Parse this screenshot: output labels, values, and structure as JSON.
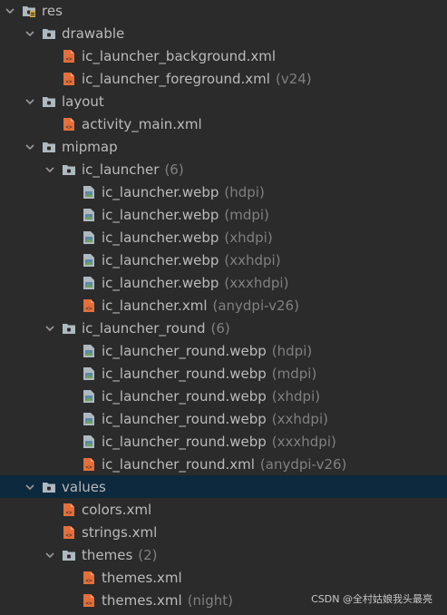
{
  "tree": [
    {
      "label": "res",
      "hint": "",
      "depth": 0,
      "kind": "folder-res",
      "expandable": true
    },
    {
      "label": "drawable",
      "hint": "",
      "depth": 1,
      "kind": "folder",
      "expandable": true
    },
    {
      "label": "ic_launcher_background.xml",
      "hint": "",
      "depth": 2,
      "kind": "xml",
      "expandable": false
    },
    {
      "label": "ic_launcher_foreground.xml",
      "hint": "(v24)",
      "depth": 2,
      "kind": "xml",
      "expandable": false
    },
    {
      "label": "layout",
      "hint": "",
      "depth": 1,
      "kind": "folder",
      "expandable": true
    },
    {
      "label": "activity_main.xml",
      "hint": "",
      "depth": 2,
      "kind": "xml",
      "expandable": false
    },
    {
      "label": "mipmap",
      "hint": "",
      "depth": 1,
      "kind": "folder",
      "expandable": true
    },
    {
      "label": "ic_launcher",
      "hint": "(6)",
      "depth": 2,
      "kind": "folder",
      "expandable": true
    },
    {
      "label": "ic_launcher.webp",
      "hint": "(hdpi)",
      "depth": 3,
      "kind": "image",
      "expandable": false
    },
    {
      "label": "ic_launcher.webp",
      "hint": "(mdpi)",
      "depth": 3,
      "kind": "image",
      "expandable": false
    },
    {
      "label": "ic_launcher.webp",
      "hint": "(xhdpi)",
      "depth": 3,
      "kind": "image",
      "expandable": false
    },
    {
      "label": "ic_launcher.webp",
      "hint": "(xxhdpi)",
      "depth": 3,
      "kind": "image",
      "expandable": false
    },
    {
      "label": "ic_launcher.webp",
      "hint": "(xxxhdpi)",
      "depth": 3,
      "kind": "image",
      "expandable": false
    },
    {
      "label": "ic_launcher.xml",
      "hint": "(anydpi-v26)",
      "depth": 3,
      "kind": "xml",
      "expandable": false
    },
    {
      "label": "ic_launcher_round",
      "hint": "(6)",
      "depth": 2,
      "kind": "folder",
      "expandable": true
    },
    {
      "label": "ic_launcher_round.webp",
      "hint": "(hdpi)",
      "depth": 3,
      "kind": "image",
      "expandable": false
    },
    {
      "label": "ic_launcher_round.webp",
      "hint": "(mdpi)",
      "depth": 3,
      "kind": "image",
      "expandable": false
    },
    {
      "label": "ic_launcher_round.webp",
      "hint": "(xhdpi)",
      "depth": 3,
      "kind": "image",
      "expandable": false
    },
    {
      "label": "ic_launcher_round.webp",
      "hint": "(xxhdpi)",
      "depth": 3,
      "kind": "image",
      "expandable": false
    },
    {
      "label": "ic_launcher_round.webp",
      "hint": "(xxxhdpi)",
      "depth": 3,
      "kind": "image",
      "expandable": false
    },
    {
      "label": "ic_launcher_round.xml",
      "hint": "(anydpi-v26)",
      "depth": 3,
      "kind": "xml",
      "expandable": false
    },
    {
      "label": "values",
      "hint": "",
      "depth": 1,
      "kind": "folder",
      "expandable": true,
      "selected": true
    },
    {
      "label": "colors.xml",
      "hint": "",
      "depth": 2,
      "kind": "xml",
      "expandable": false
    },
    {
      "label": "strings.xml",
      "hint": "",
      "depth": 2,
      "kind": "xml",
      "expandable": false
    },
    {
      "label": "themes",
      "hint": "(2)",
      "depth": 2,
      "kind": "folder",
      "expandable": true
    },
    {
      "label": "themes.xml",
      "hint": "",
      "depth": 3,
      "kind": "xml",
      "expandable": false
    },
    {
      "label": "themes.xml",
      "hint": "(night)",
      "depth": 3,
      "kind": "xml",
      "expandable": false
    }
  ],
  "watermark": "CSDN @全村姑娘我头最亮",
  "colors": {
    "background": "#2b2b2b",
    "selected_row": "#0d293e",
    "text": "#bbbbbb",
    "hint_text": "#808080",
    "folder_icon": "#aeb9c0",
    "xml_icon": "#e46f3a",
    "image_icon": "#5c88a8"
  }
}
